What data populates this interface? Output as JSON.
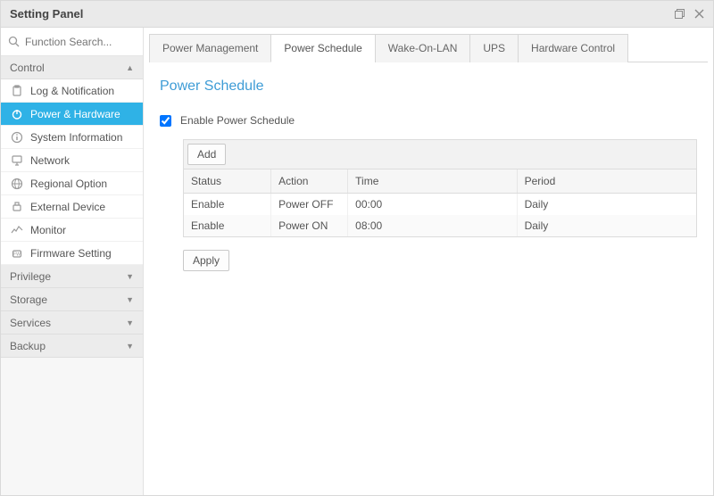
{
  "window": {
    "title": "Setting Panel"
  },
  "search": {
    "placeholder": "Function Search..."
  },
  "sections": {
    "control": {
      "label": "Control",
      "expanded": true
    },
    "privilege": {
      "label": "Privilege"
    },
    "storage": {
      "label": "Storage"
    },
    "services": {
      "label": "Services"
    },
    "backup": {
      "label": "Backup"
    }
  },
  "nav": {
    "log": "Log & Notification",
    "power": "Power & Hardware",
    "sysinfo": "System Information",
    "network": "Network",
    "regional": "Regional Option",
    "extdev": "External Device",
    "monitor": "Monitor",
    "firmware": "Firmware Setting"
  },
  "tabs": {
    "pm": "Power Management",
    "ps": "Power Schedule",
    "wol": "Wake-On-LAN",
    "ups": "UPS",
    "hw": "Hardware Control"
  },
  "page": {
    "title": "Power Schedule",
    "enable_label": "Enable Power Schedule",
    "add_button": "Add",
    "apply_button": "Apply",
    "columns": {
      "status": "Status",
      "action": "Action",
      "time": "Time",
      "period": "Period"
    },
    "rows": [
      {
        "status": "Enable",
        "action": "Power OFF",
        "time": "00:00",
        "period": "Daily"
      },
      {
        "status": "Enable",
        "action": "Power ON",
        "time": "08:00",
        "period": "Daily"
      }
    ]
  }
}
